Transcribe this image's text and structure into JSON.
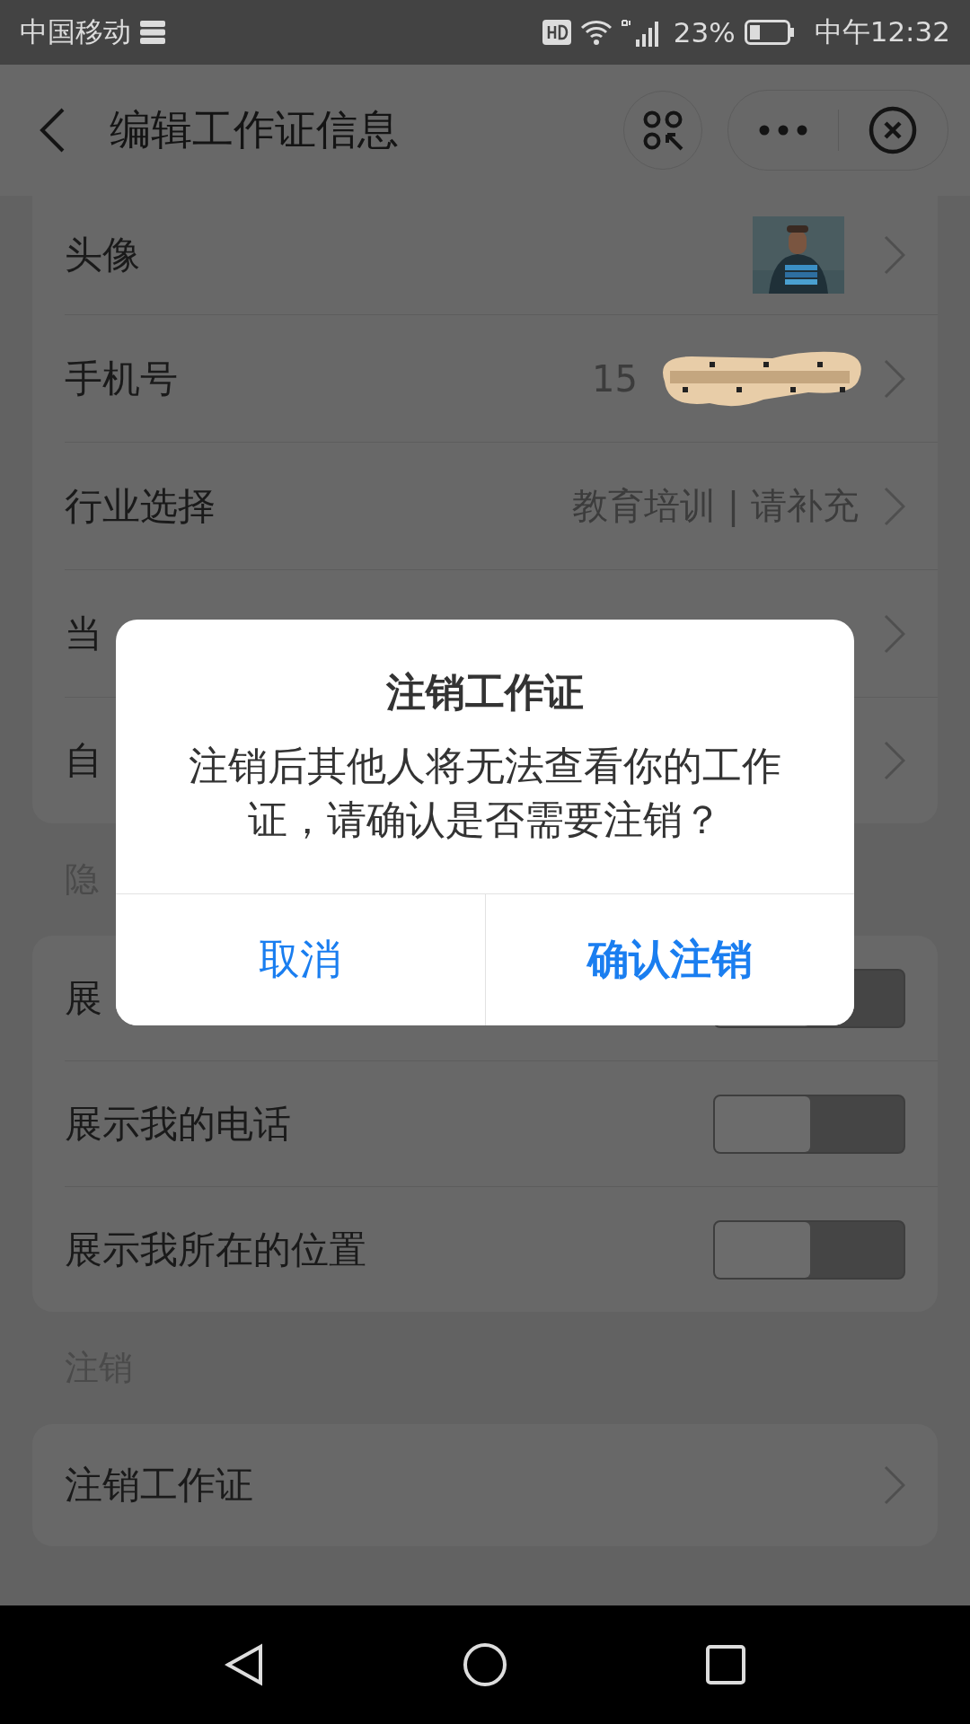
{
  "status_bar": {
    "carrier": "中国移动",
    "battery": "23%",
    "time": "中午12:32"
  },
  "header": {
    "title": "编辑工作证信息"
  },
  "profile_rows": [
    {
      "kind": "avatar",
      "label": "头像"
    },
    {
      "kind": "value",
      "label": "手机号",
      "value": "15",
      "redacted": true
    },
    {
      "kind": "value",
      "label": "行业选择",
      "value": "教育培训 | 请补充"
    },
    {
      "kind": "value",
      "label": "当"
    },
    {
      "kind": "value",
      "label": "自"
    }
  ],
  "privacy": {
    "heading": "隐",
    "rows": [
      {
        "label": "展",
        "on": false
      },
      {
        "label": "展示我的电话",
        "on": false
      },
      {
        "label": "展示我所在的位置",
        "on": false
      }
    ]
  },
  "cancel_section": {
    "heading": "注销",
    "rows": [
      {
        "label": "注销工作证"
      }
    ]
  },
  "dialog": {
    "title": "注销工作证",
    "message": "注销后其他人将无法查看你的工作证，请确认是否需要注销？",
    "buttons": [
      {
        "label": "取消",
        "primary": false
      },
      {
        "label": "确认注销",
        "primary": true
      }
    ]
  }
}
